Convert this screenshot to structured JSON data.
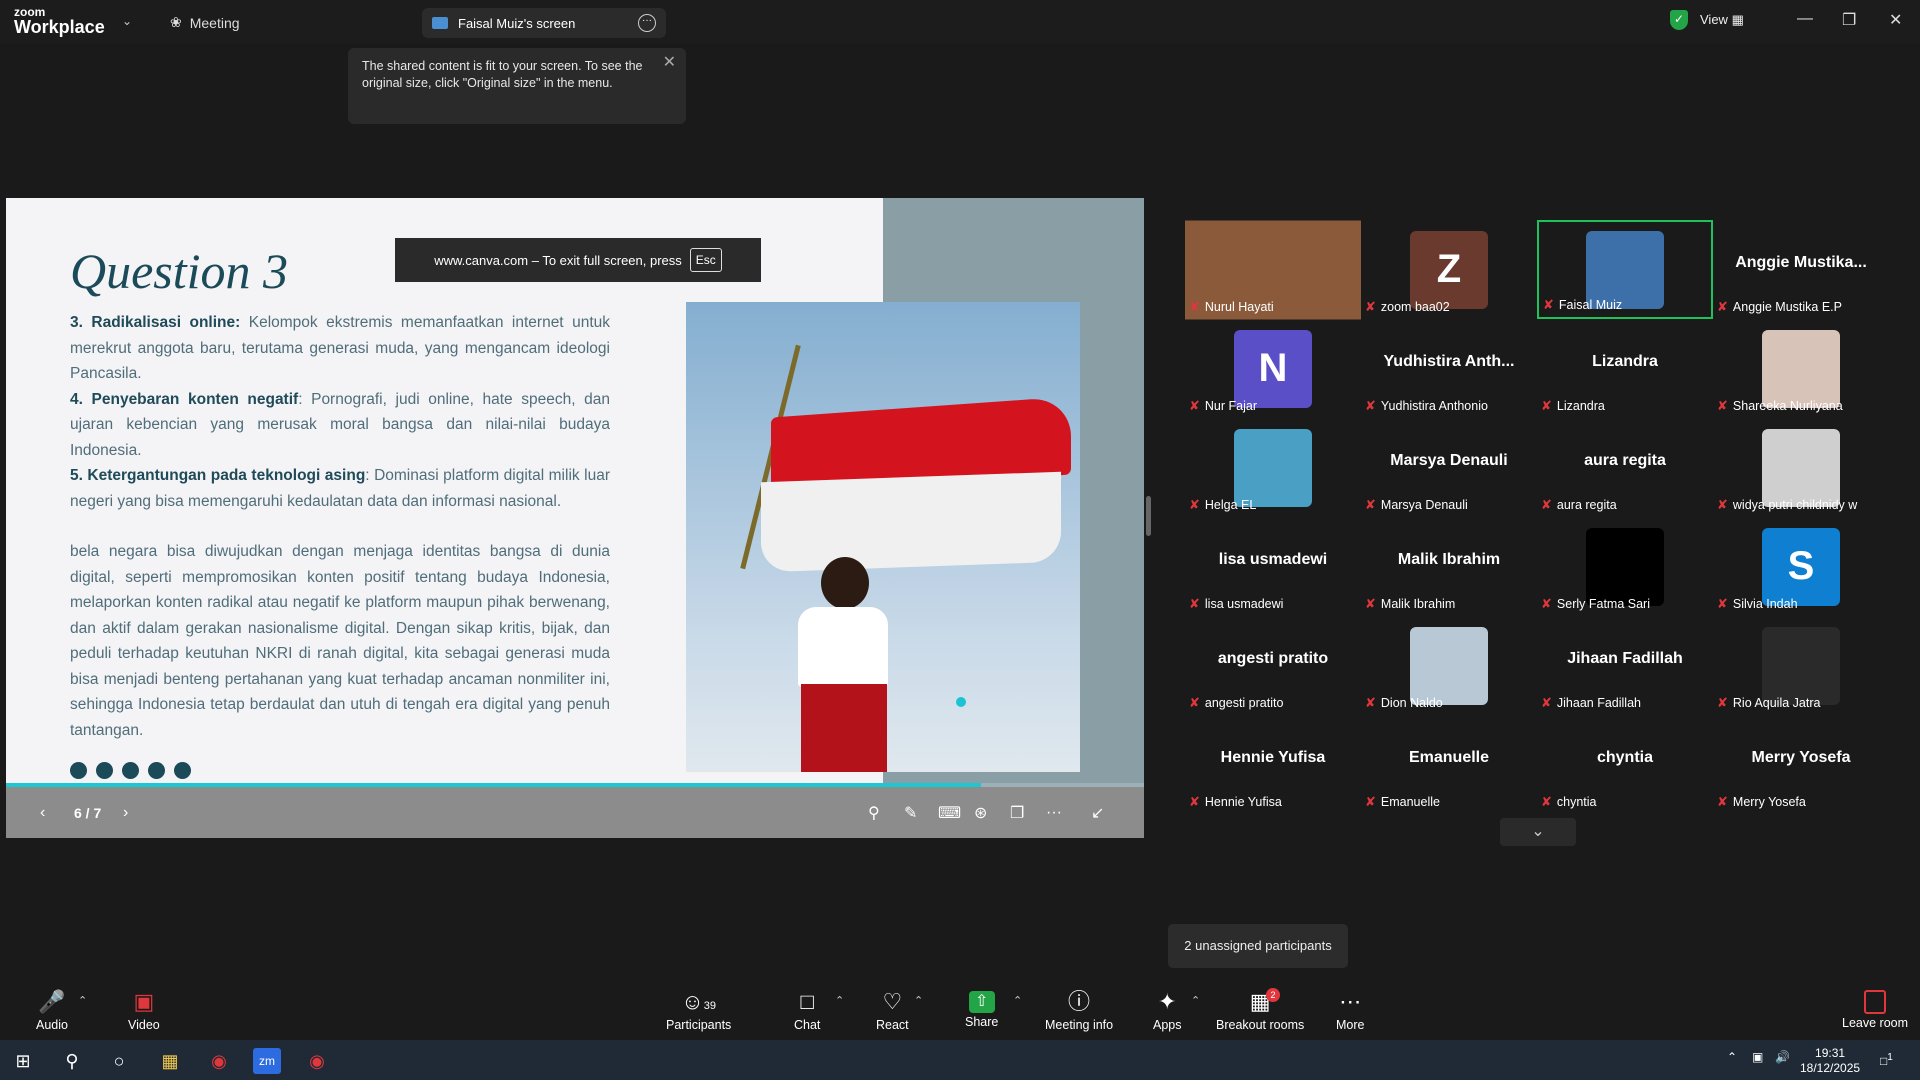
{
  "app": {
    "brand_line1": "zoom",
    "brand_line2": "Workplace",
    "meeting_tab": "Meeting",
    "screen_tab": "Faisal Muiz's screen",
    "view_label": "View"
  },
  "tooltip": {
    "text": "The shared content is fit to your screen. To see the original size, click \"Original size\" in the menu."
  },
  "slide": {
    "title": "Question 3",
    "esc_bar": "www.canva.com – To exit full screen, press",
    "esc_key": "Esc",
    "p1_bold": "3. Radikalisasi online:",
    "p1_text": " Kelompok ekstremis memanfaatkan internet untuk merekrut anggota baru, terutama generasi muda, yang mengancam ideologi Pancasila.",
    "p2_bold": "4. Penyebaran konten negatif",
    "p2_text": ": Pornografi, judi online, hate speech, dan ujaran kebencian yang merusak moral bangsa dan nilai-nilai budaya Indonesia.",
    "p3_bold": "5. Ketergantungan pada teknologi asing",
    "p3_text": ": Dominasi platform digital milik luar negeri yang bisa memengaruhi kedaulatan data dan informasi nasional.",
    "p4_text": "bela negara bisa diwujudkan dengan menjaga identitas bangsa di dunia digital, seperti mempromosikan konten positif tentang budaya Indonesia, melaporkan konten radikal atau negatif ke platform maupun pihak berwenang, dan aktif dalam gerakan nasionalisme digital. Dengan sikap kritis, bijak, dan peduli terhadap keutuhan NKRI di ranah digital, kita sebagai generasi muda bisa menjadi benteng pertahanan yang kuat terhadap ancaman nonmiliter ini, sehingga Indonesia tetap berdaulat dan utuh di tengah era digital yang penuh tantangan.",
    "page": "6 / 7",
    "progress": 0.857
  },
  "participants": [
    {
      "big": "",
      "name": "Nurul Hayati",
      "avatar": "",
      "color": "#8a5a3a"
    },
    {
      "big": "",
      "name": "zoom baa02",
      "avatar": "Z",
      "color": "#6b3a2e"
    },
    {
      "big": "",
      "name": "Faisal Muiz",
      "avatar": "",
      "color": "#3d6fa8"
    },
    {
      "big": "Anggie  Mustika...",
      "name": "Anggie Mustika E.P",
      "avatar": "",
      "color": ""
    },
    {
      "big": "",
      "name": "Nur Fajar",
      "avatar": "N",
      "color": "#5b4fc7"
    },
    {
      "big": "Yudhistira  Anth...",
      "name": "Yudhistira Anthonio",
      "avatar": "",
      "color": ""
    },
    {
      "big": "Lizandra",
      "name": "Lizandra",
      "avatar": "",
      "color": ""
    },
    {
      "big": "",
      "name": "Shareeka Nurliyana",
      "avatar": "",
      "color": "#d8c3b8"
    },
    {
      "big": "",
      "name": "Helga EL",
      "avatar": "",
      "color": "#4a9fc4"
    },
    {
      "big": "Marsya Denauli",
      "name": "Marsya Denauli",
      "avatar": "",
      "color": ""
    },
    {
      "big": "aura regita",
      "name": "aura regita",
      "avatar": "",
      "color": ""
    },
    {
      "big": "",
      "name": "widya putri childnidy w",
      "avatar": "",
      "color": "#cfcfcf"
    },
    {
      "big": "lisa usmadewi",
      "name": "lisa usmadewi",
      "avatar": "",
      "color": ""
    },
    {
      "big": "Malik Ibrahim",
      "name": "Malik Ibrahim",
      "avatar": "",
      "color": ""
    },
    {
      "big": "",
      "name": "Serly Fatma Sari",
      "avatar": "",
      "color": "#000000"
    },
    {
      "big": "",
      "name": "Silvia Indah",
      "avatar": "S",
      "color": "#0e7fd1"
    },
    {
      "big": "angesti pratito",
      "name": "angesti pratito",
      "avatar": "",
      "color": ""
    },
    {
      "big": "",
      "name": "Dion Naldo",
      "avatar": "",
      "color": "#b8c8d4"
    },
    {
      "big": "Jihaan Fadillah",
      "name": "Jihaan Fadillah",
      "avatar": "",
      "color": ""
    },
    {
      "big": "",
      "name": "Rio Aquila Jatra",
      "avatar": "",
      "color": "#2a2a2a"
    },
    {
      "big": "Hennie Yufisa",
      "name": "Hennie Yufisa",
      "avatar": "",
      "color": ""
    },
    {
      "big": "Emanuelle",
      "name": "Emanuelle",
      "avatar": "",
      "color": ""
    },
    {
      "big": "chyntia",
      "name": "chyntia",
      "avatar": "",
      "color": ""
    },
    {
      "big": "Merry Yosefa",
      "name": "Merry Yosefa",
      "avatar": "",
      "color": ""
    }
  ],
  "unassigned": "2 unassigned participants",
  "toolbar": {
    "audio": "Audio",
    "video": "Video",
    "participants": "Participants",
    "participants_count": "39",
    "chat": "Chat",
    "react": "React",
    "share": "Share",
    "meeting_info": "Meeting info",
    "apps": "Apps",
    "breakout": "Breakout rooms",
    "breakout_badge": "2",
    "more": "More",
    "leave": "Leave room"
  },
  "taskbar": {
    "time": "19:31",
    "date": "18/12/2025",
    "notif_count": "1"
  }
}
